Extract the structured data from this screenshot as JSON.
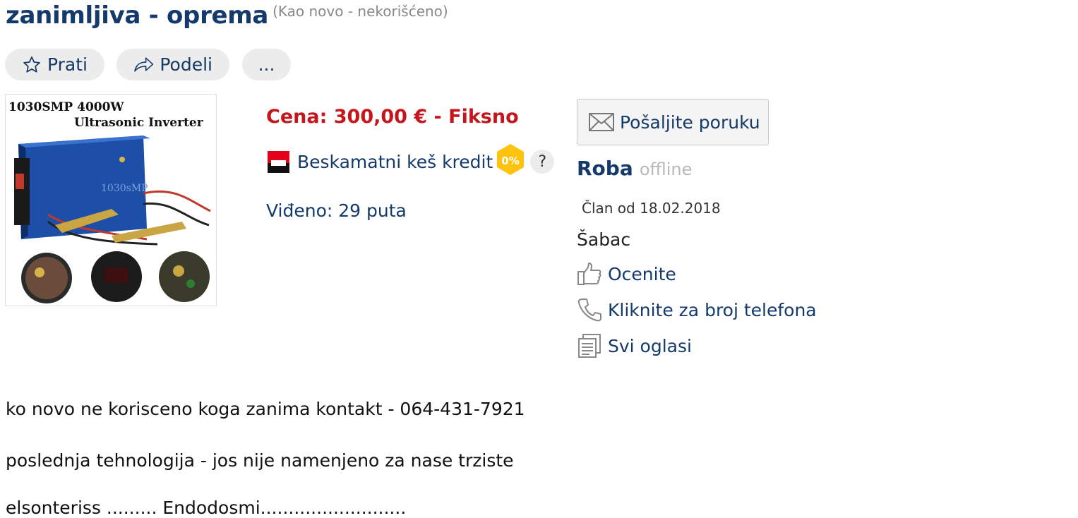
{
  "header": {
    "title": "zanimljiva - oprema",
    "condition": "(Kao novo - nekorišćeno)"
  },
  "actions": {
    "follow_label": "Prati",
    "share_label": "Podeli",
    "more_label": "..."
  },
  "photo": {
    "line1": "1030SMP 4000W",
    "line2": "Ultrasonic Inverter",
    "device_label": "1030sMP"
  },
  "listing": {
    "price": "Cena: 300,00 € - Fiksno",
    "credit_label": "Beskamatni keš kredit",
    "credit_badge": "0%",
    "help": "?",
    "views": "Viđeno: 29 puta"
  },
  "seller": {
    "send_message_label": "Pošaljite poruku",
    "name": "Roba",
    "status": "offline",
    "member_since": "Član od 18.02.2018",
    "city": "Šabac",
    "rate_label": "Ocenite",
    "phone_label": "Kliknite za broj telefona",
    "all_ads_label": "Svi oglasi"
  },
  "description": [
    "ko novo ne korisceno koga zanima kontakt - 064-431-7921",
    "poslednja tehnologija - jos nije namenjeno za nase trziste",
    "elsonteriss ......... Endodosmi.........................."
  ],
  "colors": {
    "brand": "#143a6b",
    "price": "#c4161c",
    "badge": "#ffc20e",
    "pill_bg": "#ececec"
  },
  "icons": {
    "follow": "star-outline-icon",
    "share": "share-arrow-icon",
    "credit": "bank-flag-icon",
    "message": "envelope-icon",
    "rate": "thumbs-up-icon",
    "phone": "phone-icon",
    "ads": "documents-icon"
  }
}
